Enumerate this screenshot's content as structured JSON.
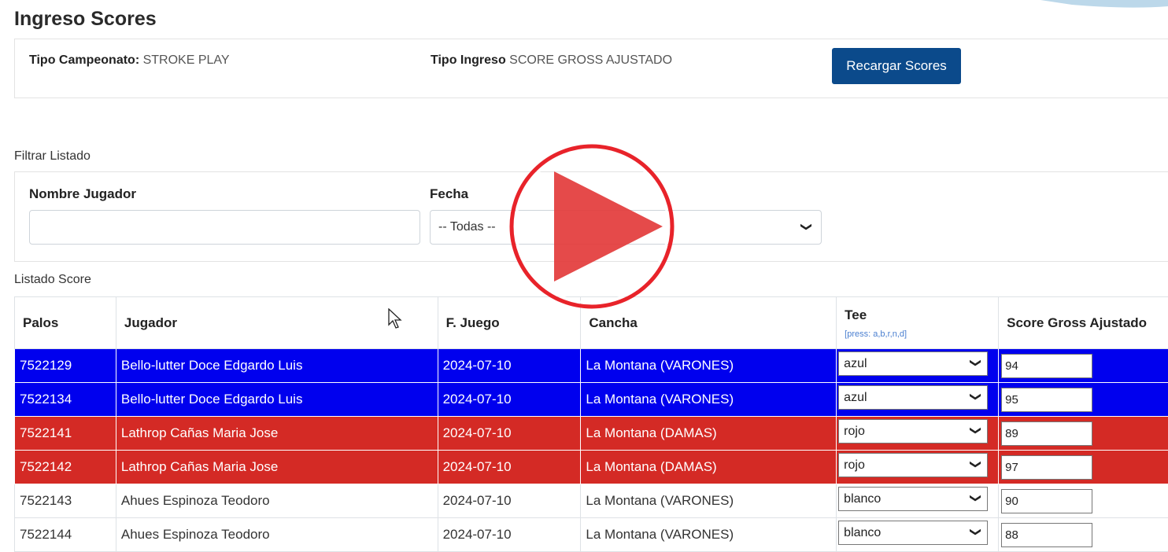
{
  "page": {
    "title": "Ingreso Scores"
  },
  "info": {
    "tipo_campeonato_label": "Tipo Campeonato:",
    "tipo_campeonato_value": "STROKE PLAY",
    "tipo_ingreso_label": "Tipo Ingreso",
    "tipo_ingreso_value": "SCORE GROSS AJUSTADO",
    "reload_button": "Recargar Scores"
  },
  "filter": {
    "section_label": "Filtrar Listado",
    "name_label": "Nombre Jugador",
    "name_value": "",
    "date_label": "Fecha",
    "date_selected": "-- Todas --"
  },
  "list": {
    "section_label": "Listado Score",
    "columns": {
      "palos": "Palos",
      "jugador": "Jugador",
      "fecha": "F. Juego",
      "cancha": "Cancha",
      "tee": "Tee",
      "tee_hint": "[press: a,b,r,n,d]",
      "score": "Score Gross Ajustado"
    },
    "rows": [
      {
        "palos": "7522129",
        "jugador": "Bello-lutter Doce Edgardo Luis",
        "fecha": "2024-07-10",
        "cancha": "La Montana (VARONES)",
        "tee": "azul",
        "score": "94"
      },
      {
        "palos": "7522134",
        "jugador": "Bello-lutter Doce Edgardo Luis",
        "fecha": "2024-07-10",
        "cancha": "La Montana (VARONES)",
        "tee": "azul",
        "score": "95"
      },
      {
        "palos": "7522141",
        "jugador": "Lathrop Cañas Maria Jose",
        "fecha": "2024-07-10",
        "cancha": "La Montana (DAMAS)",
        "tee": "rojo",
        "score": "89"
      },
      {
        "palos": "7522142",
        "jugador": "Lathrop Cañas Maria Jose",
        "fecha": "2024-07-10",
        "cancha": "La Montana (DAMAS)",
        "tee": "rojo",
        "score": "97"
      },
      {
        "palos": "7522143",
        "jugador": "Ahues Espinoza Teodoro",
        "fecha": "2024-07-10",
        "cancha": "La Montana (VARONES)",
        "tee": "blanco",
        "score": "90"
      },
      {
        "palos": "7522144",
        "jugador": "Ahues Espinoza Teodoro",
        "fecha": "2024-07-10",
        "cancha": "La Montana (VARONES)",
        "tee": "blanco",
        "score": "88"
      }
    ]
  },
  "colors": {
    "azul": "#0000ee",
    "rojo": "#d42a25",
    "button": "#0b4a8b",
    "play_red": "#e33b3b"
  },
  "icons": {
    "play": "play-icon",
    "cursor": "mouse-cursor-icon",
    "chevron": "chevron-down-icon"
  }
}
